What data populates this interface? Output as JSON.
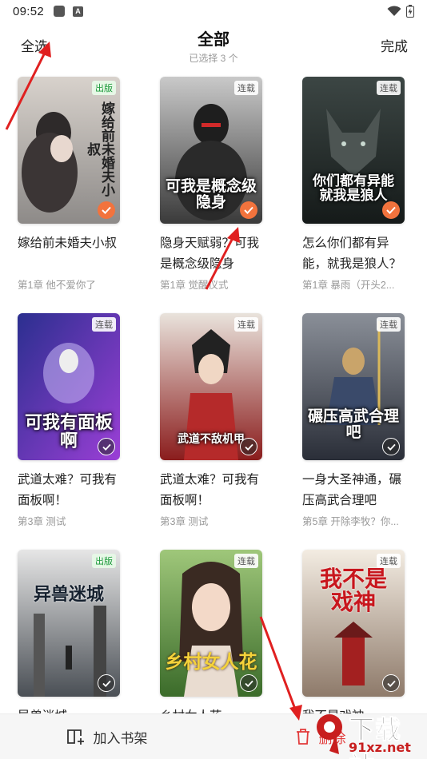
{
  "status_bar": {
    "time": "09:52",
    "icon_a": "A"
  },
  "header": {
    "select_all": "全选",
    "title": "全部",
    "subtitle": "已选择 3 个",
    "done": "完成"
  },
  "books": [
    {
      "title": "嫁给前未婚夫小叔",
      "chapter": "第1章 他不爱你了",
      "badge": "出版",
      "selected": true,
      "cover_text": "嫁给前未婚夫小叔"
    },
    {
      "title": "隐身天赋弱？可我是概念级隐身",
      "chapter": "第1章 觉醒仪式",
      "badge": "连载",
      "selected": true,
      "cover_text": "可我是概念级隐身"
    },
    {
      "title": "怎么你们都有异能，就我是狼人？",
      "chapter": "第1章 暴雨（开头2...",
      "badge": "连载",
      "selected": true,
      "cover_text": "你们都有异能就我是狼人"
    },
    {
      "title": "武道太难？可我有面板啊！",
      "chapter": "第3章 测试",
      "badge": "连载",
      "selected": false,
      "cover_text": "可我有面板啊"
    },
    {
      "title": "武道太难？可我有面板啊！",
      "chapter": "第3章 测试",
      "badge": "连载",
      "selected": false,
      "cover_text": "武道不敌机甲"
    },
    {
      "title": "一身大圣神通，碾压高武合理吧",
      "chapter": "第5章 开除李牧？你...",
      "badge": "连载",
      "selected": false,
      "cover_text": "碾压高武合理吧"
    },
    {
      "title": "异兽迷城",
      "chapter": "",
      "badge": "出版",
      "selected": false,
      "cover_text": "异兽迷城"
    },
    {
      "title": "乡村女人花",
      "chapter": "",
      "badge": "连载",
      "selected": false,
      "cover_text": "乡村女人花"
    },
    {
      "title": "我不是戏神",
      "chapter": "",
      "badge": "连载",
      "selected": false,
      "cover_text": "我不是戏神"
    }
  ],
  "bottom_bar": {
    "add_label": "加入书架",
    "delete_label": "删除"
  },
  "watermark": {
    "main": "下载站",
    "url": "91xz.net"
  },
  "colors": {
    "accent": "#f2733d",
    "delete": "#e23b3b",
    "arrow": "#e02020"
  }
}
